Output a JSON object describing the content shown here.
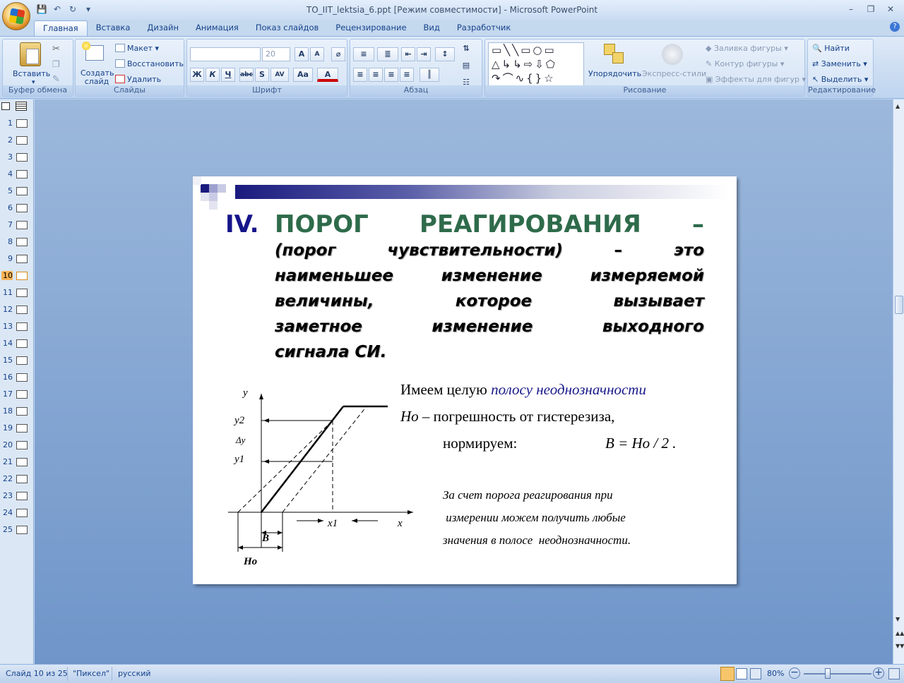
{
  "window": {
    "title": "TO_IIT_lektsia_6.ppt [Режим совместимости] - Microsoft PowerPoint"
  },
  "tabs": [
    "Главная",
    "Вставка",
    "Дизайн",
    "Анимация",
    "Показ слайдов",
    "Рецензирование",
    "Вид",
    "Разработчик"
  ],
  "ribbon": {
    "clipboard": {
      "label": "Буфер обмена",
      "paste": "Вставить"
    },
    "slides": {
      "label": "Слайды",
      "new_slide": "Создать слайд",
      "layout": "Макет",
      "reset": "Восстановить",
      "delete": "Удалить"
    },
    "font": {
      "label": "Шрифт",
      "size": "20"
    },
    "paragraph": {
      "label": "Абзац"
    },
    "drawing": {
      "label": "Рисование",
      "arrange": "Упорядочить",
      "quick_styles": "Экспресс-стили",
      "fill": "Заливка фигуры",
      "outline": "Контур фигуры",
      "effects": "Эффекты для фигур"
    },
    "editing": {
      "label": "Редактирование",
      "find": "Найти",
      "replace": "Заменить",
      "select": "Выделить"
    }
  },
  "thumbnails": {
    "count": 25,
    "active": 10
  },
  "slide": {
    "numeral": "IV.",
    "heading_line1": "ПОРОГ РЕАГИРОВАНИЯ –",
    "heading_lines": [
      "(порог чувствительности) – это",
      "наименьшее изменение измеряемой",
      "величины, которое вызывает",
      "заметное изменение выходного",
      "сигнала СИ."
    ],
    "text_line1_a": "Имеем целую ",
    "text_line1_b": "полосу неоднозначности",
    "text_line2_a": "Но",
    "text_line2_b": " – погрешность от гистерезиза,",
    "text_line3_a": "нормируем:",
    "text_line3_b": "B = Но / 2 .",
    "note_lines": [
      "За счет порога реагирования при",
      " измерении можем получить любые",
      "значения в полосе  неоднозначности."
    ],
    "graph": {
      "y": "y",
      "y2": "y2",
      "dy": "Δy",
      "y1": "y1",
      "x": "x",
      "x1": "x1",
      "B": "B",
      "Ho": "Hо"
    }
  },
  "status": {
    "slide": "Слайд 10 из 25",
    "theme": "\"Пиксел\"",
    "lang": "русский",
    "zoom": "80%"
  }
}
